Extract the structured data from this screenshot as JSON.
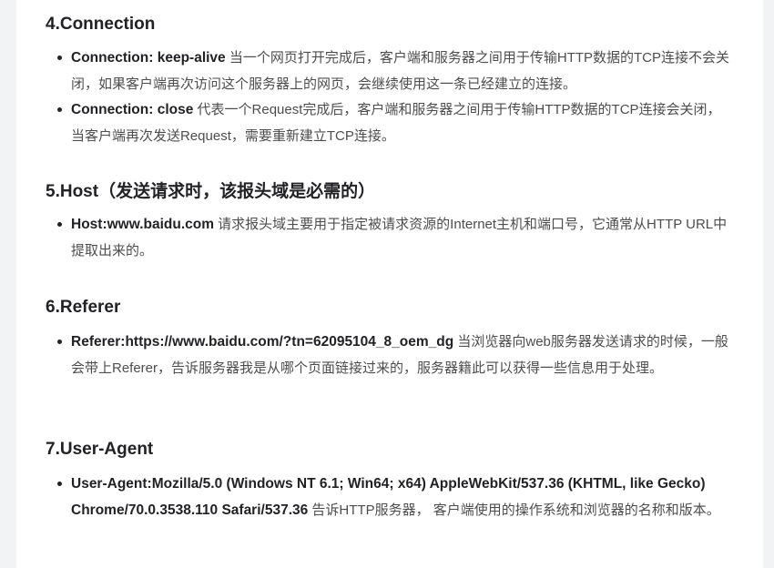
{
  "sections": [
    {
      "title": "4.Connection",
      "items": [
        {
          "strong": "Connection: keep-alive",
          "text": "  当一个网页打开完成后，客户端和服务器之间用于传输HTTP数据的TCP连接不会关闭，如果客户端再次访问这个服务器上的网页，会继续使用这一条已经建立的连接。"
        },
        {
          "strong": " Connection: close",
          "text": " 代表一个Request完成后，客户端和服务器之间用于传输HTTP数据的TCP连接会关闭， 当客户端再次发送Request，需要重新建立TCP连接。"
        }
      ]
    },
    {
      "title": "5.Host（发送请求时，该报头域是必需的）",
      "items": [
        {
          "strong": "Host:www.baidu.com",
          "text": " 请求报头域主要用于指定被请求资源的Internet主机和端口号，它通常从HTTP URL中提取出来的。"
        }
      ]
    },
    {
      "title": "6.Referer",
      "items": [
        {
          "strong": "Referer:https://www.baidu.com/?tn=62095104_8_oem_dg",
          "text": " 当浏览器向web服务器发送请求的时候，一般会带上Referer，告诉服务器我是从哪个页面链接过来的，服务器籍此可以获得一些信息用于处理。"
        }
      ]
    },
    {
      "title": "7.User-Agent",
      "items": [
        {
          "strong": "User-Agent:Mozilla/5.0 (Windows NT 6.1; Win64; x64) AppleWebKit/537.36 (KHTML, like Gecko) Chrome/70.0.3538.110 Safari/537.36",
          "text": " 告诉HTTP服务器， 客户端使用的操作系统和浏览器的名称和版本。"
        }
      ]
    }
  ]
}
